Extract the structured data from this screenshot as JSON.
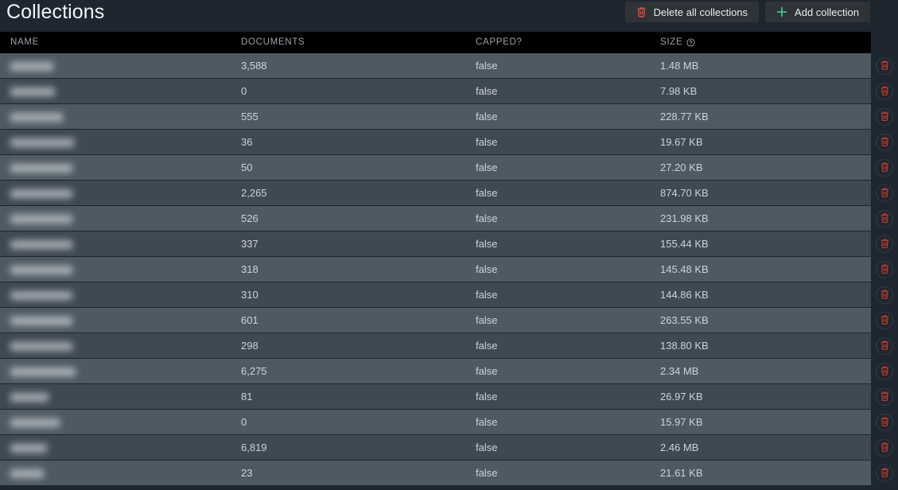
{
  "header": {
    "title": "Collections",
    "actions": [
      {
        "label": "Delete all collections",
        "icon": "trash-icon",
        "icon_color": "#e74c3c",
        "name": "delete-all-collections-button"
      },
      {
        "label": "Add collection",
        "icon": "plus-icon",
        "icon_color": "#2ecc8f",
        "name": "add-collection-button"
      }
    ]
  },
  "table": {
    "columns": [
      {
        "key": "name",
        "label": "NAME"
      },
      {
        "key": "documents",
        "label": "DOCUMENTS"
      },
      {
        "key": "capped",
        "label": "CAPPED?"
      },
      {
        "key": "size",
        "label": "SIZE",
        "info_icon": "help-circle-icon"
      }
    ],
    "row_action": {
      "icon": "trash-icon",
      "label": "Delete collection",
      "color": "#c0392b"
    },
    "name_column_redacted": true,
    "rows": [
      {
        "name": "",
        "documents": "3,588",
        "capped": "false",
        "size": "1.48 MB"
      },
      {
        "name": "",
        "documents": "0",
        "capped": "false",
        "size": "7.98 KB"
      },
      {
        "name": "",
        "documents": "555",
        "capped": "false",
        "size": "228.77 KB"
      },
      {
        "name": "",
        "documents": "36",
        "capped": "false",
        "size": "19.67 KB"
      },
      {
        "name": "",
        "documents": "50",
        "capped": "false",
        "size": "27.20 KB"
      },
      {
        "name": "",
        "documents": "2,265",
        "capped": "false",
        "size": "874.70 KB"
      },
      {
        "name": "",
        "documents": "526",
        "capped": "false",
        "size": "231.98 KB"
      },
      {
        "name": "",
        "documents": "337",
        "capped": "false",
        "size": "155.44 KB"
      },
      {
        "name": "",
        "documents": "318",
        "capped": "false",
        "size": "145.48 KB"
      },
      {
        "name": "",
        "documents": "310",
        "capped": "false",
        "size": "144.86 KB"
      },
      {
        "name": "",
        "documents": "601",
        "capped": "false",
        "size": "263.55 KB"
      },
      {
        "name": "",
        "documents": "298",
        "capped": "false",
        "size": "138.80 KB"
      },
      {
        "name": "",
        "documents": "6,275",
        "capped": "false",
        "size": "2.34 MB"
      },
      {
        "name": "",
        "documents": "81",
        "capped": "false",
        "size": "26.97 KB"
      },
      {
        "name": "",
        "documents": "0",
        "capped": "false",
        "size": "15.97 KB"
      },
      {
        "name": "",
        "documents": "6,819",
        "capped": "false",
        "size": "2.46 MB"
      },
      {
        "name": "",
        "documents": "23",
        "capped": "false",
        "size": "21.61 KB"
      }
    ]
  },
  "colors": {
    "page_background": "#1e262f",
    "header_row_background": "#000000",
    "row_odd": "#4e5a63",
    "row_even": "#3f4954",
    "button_background": "#2f3337",
    "accent_danger": "#e74c3c",
    "accent_success": "#2ecc8f",
    "text_primary": "#ccd3d8",
    "text_muted": "#9aa3ab"
  }
}
